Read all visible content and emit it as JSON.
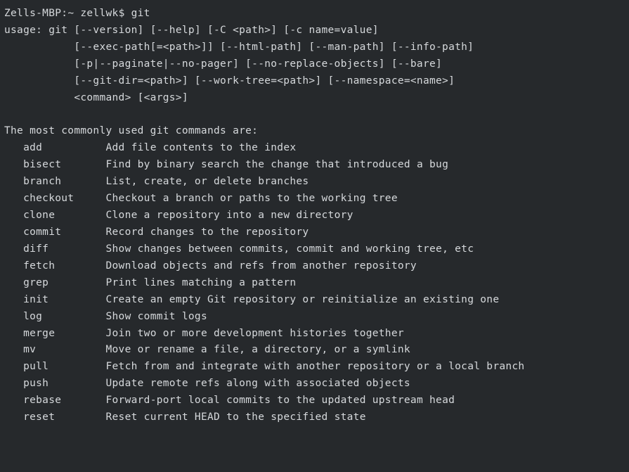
{
  "prompt": {
    "host": "Zells-MBP",
    "path": "~",
    "user": "zellwk",
    "symbol": "$",
    "command": "git"
  },
  "usage": {
    "label": "usage:",
    "bin": "git",
    "lines": [
      "[--version] [--help] [-C <path>] [-c name=value]",
      "[--exec-path[=<path>]] [--html-path] [--man-path] [--info-path]",
      "[-p|--paginate|--no-pager] [--no-replace-objects] [--bare]",
      "[--git-dir=<path>] [--work-tree=<path>] [--namespace=<name>]",
      "<command> [<args>]"
    ]
  },
  "section_header": "The most commonly used git commands are:",
  "commands": [
    {
      "name": "add",
      "desc": "Add file contents to the index"
    },
    {
      "name": "bisect",
      "desc": "Find by binary search the change that introduced a bug"
    },
    {
      "name": "branch",
      "desc": "List, create, or delete branches"
    },
    {
      "name": "checkout",
      "desc": "Checkout a branch or paths to the working tree"
    },
    {
      "name": "clone",
      "desc": "Clone a repository into a new directory"
    },
    {
      "name": "commit",
      "desc": "Record changes to the repository"
    },
    {
      "name": "diff",
      "desc": "Show changes between commits, commit and working tree, etc"
    },
    {
      "name": "fetch",
      "desc": "Download objects and refs from another repository"
    },
    {
      "name": "grep",
      "desc": "Print lines matching a pattern"
    },
    {
      "name": "init",
      "desc": "Create an empty Git repository or reinitialize an existing one"
    },
    {
      "name": "log",
      "desc": "Show commit logs"
    },
    {
      "name": "merge",
      "desc": "Join two or more development histories together"
    },
    {
      "name": "mv",
      "desc": "Move or rename a file, a directory, or a symlink"
    },
    {
      "name": "pull",
      "desc": "Fetch from and integrate with another repository or a local branch"
    },
    {
      "name": "push",
      "desc": "Update remote refs along with associated objects"
    },
    {
      "name": "rebase",
      "desc": "Forward-port local commits to the updated upstream head"
    },
    {
      "name": "reset",
      "desc": "Reset current HEAD to the specified state"
    }
  ]
}
